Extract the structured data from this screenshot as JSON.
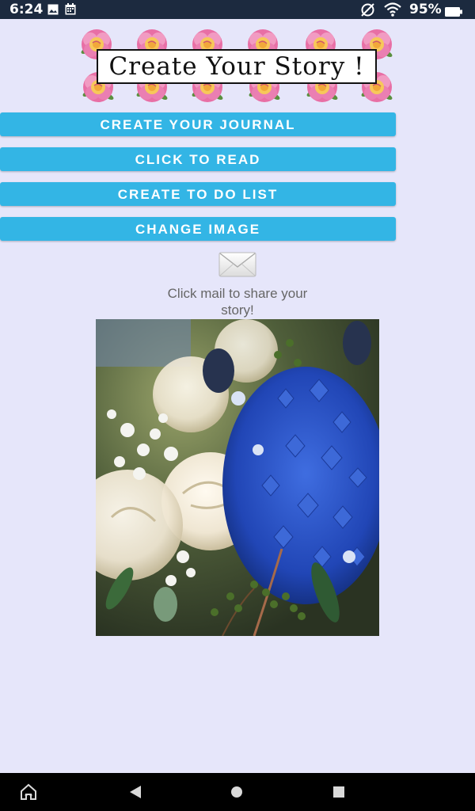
{
  "status_bar": {
    "time": "6:24",
    "battery": "95%",
    "icons": [
      "image-icon",
      "calendar-icon",
      "no-sim-icon",
      "wifi-icon",
      "battery-icon"
    ]
  },
  "header": {
    "title": "Create Your Story !"
  },
  "buttons": {
    "journal": "CREATE YOUR JOURNAL",
    "read": "CLICK TO READ",
    "todo": "CREATE TO DO LIST",
    "change_image": "CHANGE IMAGE"
  },
  "share": {
    "icon": "mail-icon",
    "text": "Click mail to share your story!"
  },
  "photo": {
    "icon": "flower-bouquet-image"
  },
  "nav_bar": {
    "icons": [
      "home-icon",
      "back-icon",
      "home-circle-icon",
      "recents-icon"
    ]
  },
  "colors": {
    "background": "#e6e6fa",
    "button": "#33b5e5",
    "status_bar": "#1c2a3f"
  }
}
